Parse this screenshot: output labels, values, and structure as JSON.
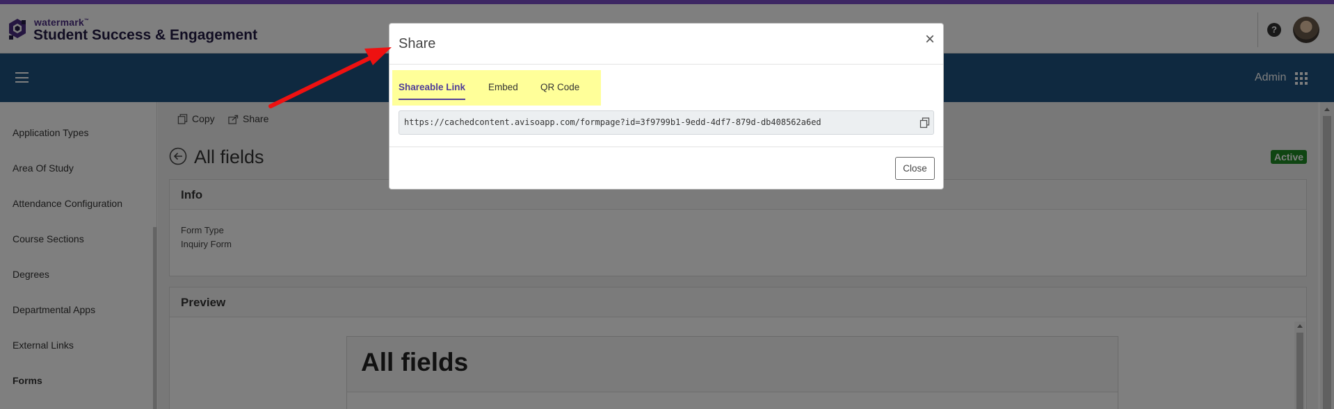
{
  "header": {
    "brand_small": "watermark",
    "brand_tm": "™",
    "brand_title": "Student Success & Engagement"
  },
  "navbar": {
    "admin_label": "Admin"
  },
  "sidebar": {
    "items": [
      {
        "label": "Application Types"
      },
      {
        "label": "Area Of Study"
      },
      {
        "label": "Attendance Configuration"
      },
      {
        "label": "Course Sections"
      },
      {
        "label": "Degrees"
      },
      {
        "label": "Departmental Apps"
      },
      {
        "label": "External Links"
      },
      {
        "label": "Forms"
      }
    ]
  },
  "main": {
    "toolbar": {
      "copy_label": "Copy",
      "share_label": "Share"
    },
    "page_title": "All fields",
    "status": "Active",
    "info_card": {
      "title": "Info",
      "field_label": "Form Type",
      "field_value": "Inquiry Form"
    },
    "preview_card": {
      "title": "Preview",
      "form_title": "All fields"
    }
  },
  "modal": {
    "title": "Share",
    "tabs": [
      {
        "label": "Shareable Link"
      },
      {
        "label": "Embed"
      },
      {
        "label": "QR Code"
      }
    ],
    "link": "https://cachedcontent.avisoapp.com/formpage?id=3f9799b1-9edd-4df7-879d-db408562a6ed",
    "close_label": "Close"
  },
  "colors": {
    "brand_purple": "#7b4fc7",
    "navbar_blue": "#1f5380",
    "active_green": "#1e8a25",
    "tab_active": "#4f3c99",
    "highlight_yellow": "#ffff99",
    "annotation_red": "#ee1111"
  }
}
